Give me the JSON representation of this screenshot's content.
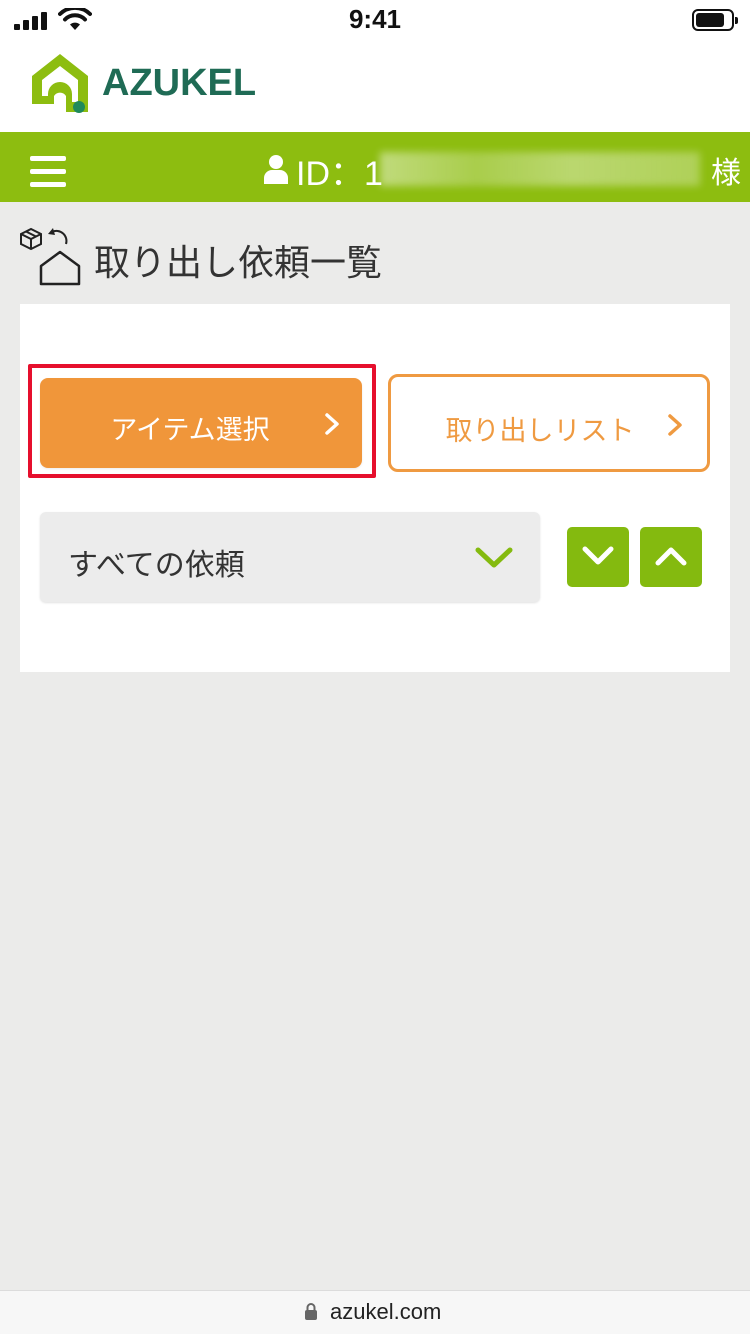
{
  "status_bar": {
    "time": "9:41"
  },
  "brand": {
    "name": "AZUKEL",
    "colors": {
      "logo_green": "#8dbd10",
      "logo_text": "#1f6b55"
    }
  },
  "nav": {
    "id_label": "ID：1",
    "honorific": "様",
    "bar_color": "#8dbd10"
  },
  "page": {
    "title": "取り出し依頼一覧"
  },
  "actions": {
    "select_items_label": "アイテム選択",
    "pickup_list_label": "取り出しリスト",
    "primary_color": "#f0963a",
    "highlight_color": "#e60f2d"
  },
  "filter": {
    "selected": "すべての依頼"
  },
  "browser": {
    "url": "azukel.com"
  }
}
